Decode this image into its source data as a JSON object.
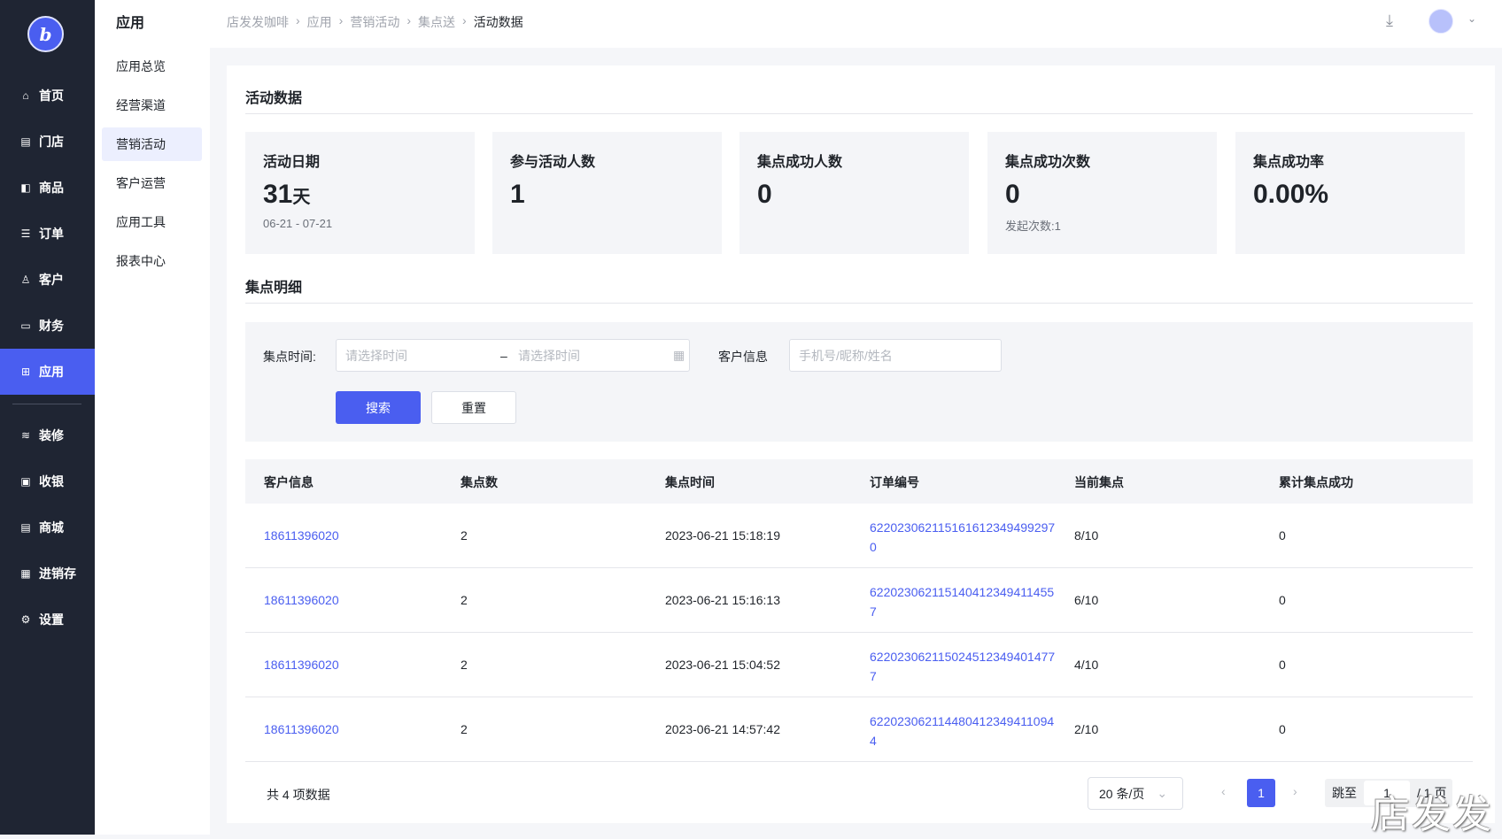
{
  "sidebar": {
    "logo": "b",
    "items": [
      {
        "label": "首页",
        "icon": "home-icon"
      },
      {
        "label": "门店",
        "icon": "store-icon"
      },
      {
        "label": "商品",
        "icon": "bag-icon"
      },
      {
        "label": "订单",
        "icon": "order-icon"
      },
      {
        "label": "客户",
        "icon": "user-icon"
      },
      {
        "label": "财务",
        "icon": "wallet-icon"
      },
      {
        "label": "应用",
        "icon": "apps-icon"
      },
      {
        "label": "装修",
        "icon": "layers-icon"
      },
      {
        "label": "收银",
        "icon": "cashier-icon"
      },
      {
        "label": "商城",
        "icon": "mall-icon"
      },
      {
        "label": "进销存",
        "icon": "inventory-icon"
      },
      {
        "label": "设置",
        "icon": "settings-icon"
      }
    ]
  },
  "submenu": {
    "title": "应用",
    "items": [
      "应用总览",
      "经营渠道",
      "营销活动",
      "客户运营",
      "应用工具",
      "报表中心"
    ]
  },
  "breadcrumb": [
    "店发发咖啡",
    "应用",
    "营销活动",
    "集点送",
    "活动数据"
  ],
  "section1": "活动数据",
  "stats": [
    {
      "label": "活动日期",
      "value": "31",
      "unit": "天",
      "sub": "06-21 - 07-21"
    },
    {
      "label": "参与活动人数",
      "value": "1"
    },
    {
      "label": "集点成功人数",
      "value": "0"
    },
    {
      "label": "集点成功次数",
      "value": "0",
      "sub": "发起次数:1"
    },
    {
      "label": "集点成功率",
      "value": "0.00%"
    }
  ],
  "section2": "集点明细",
  "filter": {
    "time_label": "集点时间:",
    "start_ph": "请选择时间",
    "sep": "–",
    "end_ph": "请选择时间",
    "cust_label": "客户信息",
    "cust_ph": "手机号/昵称/姓名",
    "search": "搜索",
    "reset": "重置"
  },
  "table": {
    "headers": [
      "客户信息",
      "集点数",
      "集点时间",
      "订单编号",
      "当前集点",
      "累计集点成功"
    ],
    "rows": [
      [
        "18611396020",
        "2",
        "2023-06-21 15:18:19",
        "622023062115161612349499297​0",
        "8/10",
        "0"
      ],
      [
        "18611396020",
        "2",
        "2023-06-21 15:16:13",
        "6220230621151404123494114557",
        "6/10",
        "0"
      ],
      [
        "18611396020",
        "2",
        "2023-06-21 15:04:52",
        "6220230621150245123494014777",
        "4/10",
        "0"
      ],
      [
        "18611396020",
        "2",
        "2023-06-21 14:57:42",
        "6220230621144804123494110944",
        "2/10",
        "0"
      ]
    ]
  },
  "pagination": {
    "total": "共 4 项数据",
    "page_size": "20 条/页",
    "current": "1",
    "jump_label": "跳至",
    "jump_value": "1",
    "pages": "/ 1 页"
  },
  "watermark": "店发发"
}
